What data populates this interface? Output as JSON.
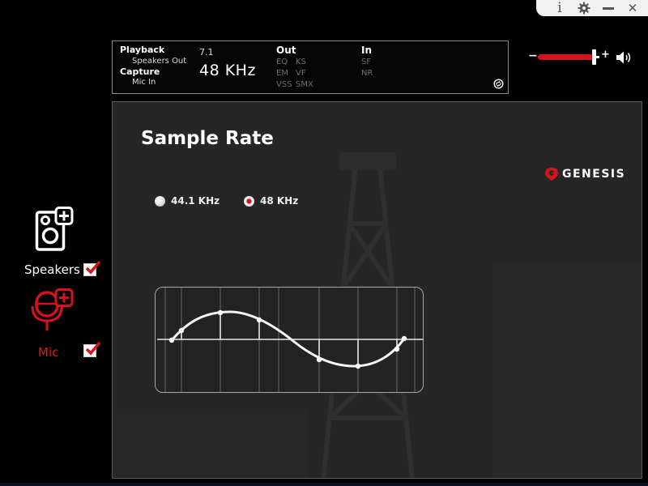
{
  "window_controls": {
    "info_label": "i",
    "settings_icon": "gear-icon",
    "minimize_icon": "minimize-icon",
    "close_label": "✕"
  },
  "status": {
    "playback_label": "Playback",
    "playback_device": "Speakers Out",
    "capture_label": "Capture",
    "capture_device": "Mic In",
    "channels": "7.1",
    "sample_rate_display": "48  KHz",
    "out_label": "Out",
    "out_effects": [
      "EQ",
      "KS",
      "EM",
      "VF",
      "VSS",
      "SMX"
    ],
    "in_label": "In",
    "in_effects": [
      "SF",
      "NR"
    ]
  },
  "volume": {
    "minus_label": "−",
    "plus_label": "+",
    "level_percent": 95
  },
  "sidebar": {
    "speakers_label": "Speakers",
    "speakers_checked": true,
    "mic_label": "Mic",
    "mic_checked": true
  },
  "main": {
    "title": "Sample Rate",
    "brand": "GENESIS",
    "options": [
      {
        "label": "44.1 KHz",
        "selected": false
      },
      {
        "label": "48 KHz",
        "selected": true
      }
    ]
  },
  "colors": {
    "accent": "#d4131c",
    "panel_bg": "#262626",
    "background": "#000000"
  }
}
